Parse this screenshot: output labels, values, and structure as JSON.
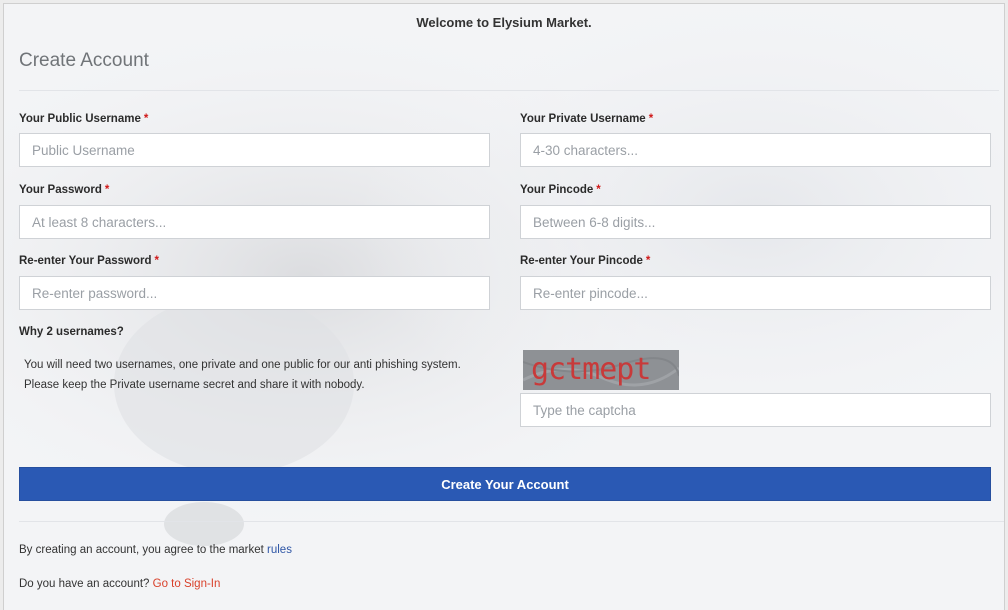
{
  "banner": {
    "text": "Welcome to Elysium Market."
  },
  "page": {
    "title": "Create Account"
  },
  "form": {
    "public_username": {
      "label": "Your Public Username",
      "required_mark": "*",
      "placeholder": "Public Username",
      "value": ""
    },
    "private_username": {
      "label": "Your Private Username",
      "required_mark": "*",
      "placeholder": "4-30 characters...",
      "value": ""
    },
    "password": {
      "label": "Your Password",
      "required_mark": "*",
      "placeholder": "At least 8 characters...",
      "value": ""
    },
    "pincode": {
      "label": "Your Pincode",
      "required_mark": "*",
      "placeholder": "Between 6-8 digits...",
      "value": ""
    },
    "password_confirm": {
      "label": "Re-enter Your Password",
      "required_mark": "*",
      "placeholder": "Re-enter password...",
      "value": ""
    },
    "pincode_confirm": {
      "label": "Re-enter Your Pincode",
      "required_mark": "*",
      "placeholder": "Re-enter pincode...",
      "value": ""
    },
    "captcha": {
      "text": "gctmept",
      "placeholder": "Type the captcha",
      "value": ""
    },
    "submit_label": "Create Your Account"
  },
  "info": {
    "title": "Why 2 usernames?",
    "text": "You will need two usernames, one private and one public for our anti phishing system. Please keep the Private username secret and share it with nobody."
  },
  "footer": {
    "terms_text": "By creating an account, you agree to the market ",
    "terms_link": "rules",
    "signin_text": "Do you have an account? ",
    "signin_link": "Go to Sign-In"
  },
  "colors": {
    "primary_button": "#2a59b4",
    "required": "#d01919",
    "link_blue": "#2f56a6",
    "link_red": "#d9412b"
  }
}
